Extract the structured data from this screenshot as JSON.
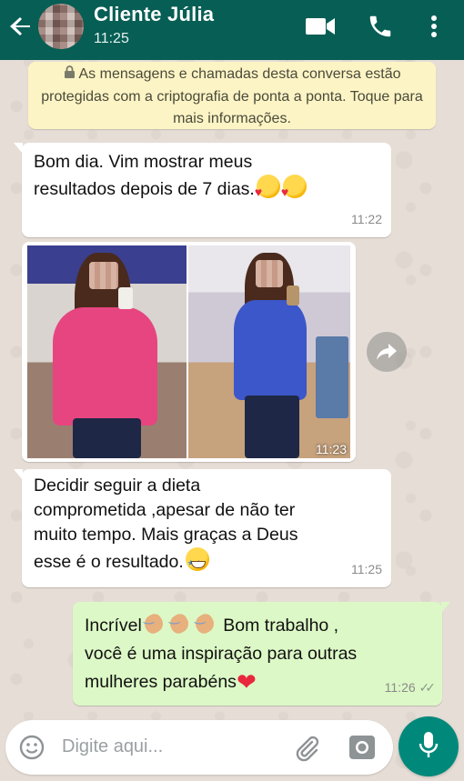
{
  "header": {
    "contact_name": "Cliente Júlia",
    "status": "11:25"
  },
  "icons": {
    "back": "arrow-left-icon",
    "video": "video-camera-icon",
    "call": "phone-icon",
    "menu": "more-vertical-icon",
    "lock": "lock-icon",
    "forward": "forward-icon",
    "emoji": "emoji-smile-icon",
    "attach": "paperclip-icon",
    "camera": "camera-icon",
    "mic": "microphone-icon"
  },
  "notice": {
    "text": "As mensagens e chamadas desta conversa estão protegidas com a criptografia de ponta a ponta. Toque para mais informações."
  },
  "messages": [
    {
      "direction": "incoming",
      "line1": "Bom dia. Vim mostrar meus",
      "line2": "resultados depois de 7 dias.",
      "time": "11:22"
    },
    {
      "direction": "incoming",
      "type": "photo",
      "time": "11:23"
    },
    {
      "direction": "incoming",
      "line1": "Decidir seguir a dieta",
      "line2": "comprometida ,apesar de não ter",
      "line3": "muito tempo. Mais graças a Deus",
      "line4": "esse é o resultado.",
      "time": "11:25"
    },
    {
      "direction": "outgoing",
      "line1a": "Incrível",
      "line1b": " Bom trabalho ,",
      "line2": "você é uma inspiração para outras",
      "line3": "mulheres parabéns",
      "time": "11:26",
      "ticks": "✓✓"
    }
  ],
  "composer": {
    "placeholder": "Digite aqui..."
  },
  "colors": {
    "header": "#075e54",
    "incoming": "#ffffff",
    "outgoing": "#dcf8c6",
    "notice": "#fdf4c5",
    "accent": "#00897b"
  }
}
